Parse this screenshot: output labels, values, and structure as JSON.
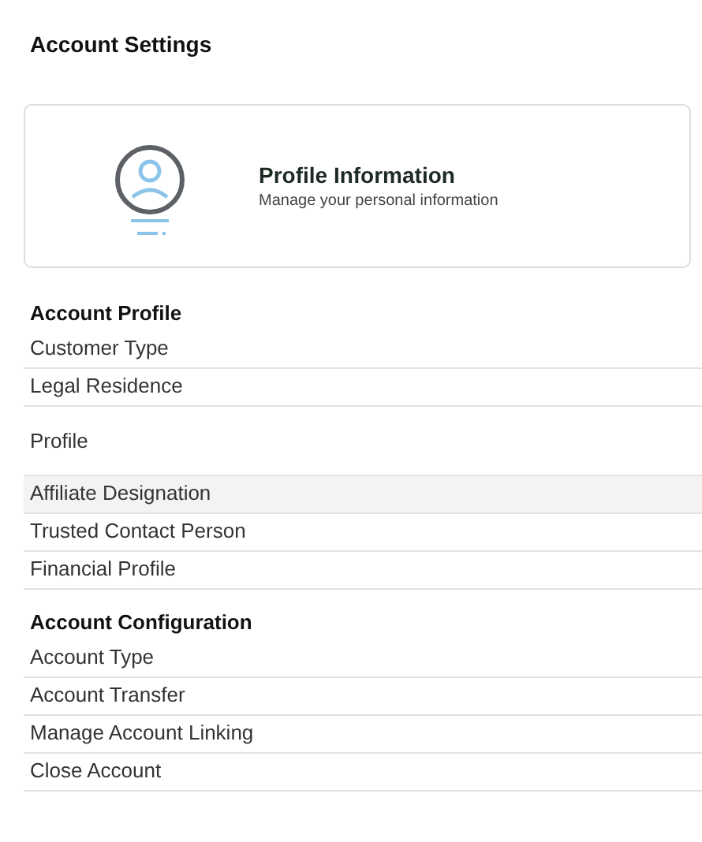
{
  "page_title": "Account Settings",
  "profile_card": {
    "title": "Profile Information",
    "subtitle": "Manage your personal information"
  },
  "sections": [
    {
      "title": "Account Profile",
      "items": [
        {
          "label": "Customer Type",
          "kind": "row",
          "selected": false
        },
        {
          "label": "Legal Residence",
          "kind": "row",
          "selected": false
        },
        {
          "label": "Profile",
          "kind": "spaced",
          "selected": false
        },
        {
          "label": "Affiliate Designation",
          "kind": "row",
          "selected": true
        },
        {
          "label": "Trusted Contact Person",
          "kind": "row",
          "selected": false
        },
        {
          "label": "Financial Profile",
          "kind": "row",
          "selected": false
        }
      ]
    },
    {
      "title": "Account Configuration",
      "items": [
        {
          "label": "Account Type",
          "kind": "row",
          "selected": false
        },
        {
          "label": "Account Transfer",
          "kind": "row",
          "selected": false
        },
        {
          "label": "Manage Account Linking",
          "kind": "row",
          "selected": false
        },
        {
          "label": "Close Account",
          "kind": "row",
          "selected": false
        }
      ]
    }
  ]
}
